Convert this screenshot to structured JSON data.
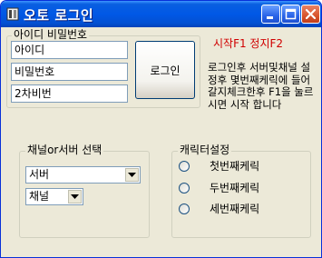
{
  "window": {
    "title": "오토 로그인"
  },
  "login": {
    "group_label": "아이디 비밀번호",
    "id_field": "아이디",
    "password_field": "비밀번호",
    "second_password_field": "2차비번",
    "login_button": "로그인"
  },
  "hotkey_note": "시작F1 정지F2",
  "instructions": "로그인후 서버및채널 설정후 몇번째케릭에 들어갈지체크한후 F1을 눌르시면 시작 합니다",
  "server_group": {
    "label": "채널or서버 선택",
    "server_select": "서버",
    "channel_select": "채널"
  },
  "character_group": {
    "label": "캐릭터설정",
    "options": [
      "첫번째케릭",
      "두번째케릭",
      "세번째케릭"
    ]
  },
  "colors": {
    "titlebar": "#0058e6",
    "window_bg": "#ece9d8",
    "note_red": "#d00000",
    "close_button": "#d8542c"
  }
}
